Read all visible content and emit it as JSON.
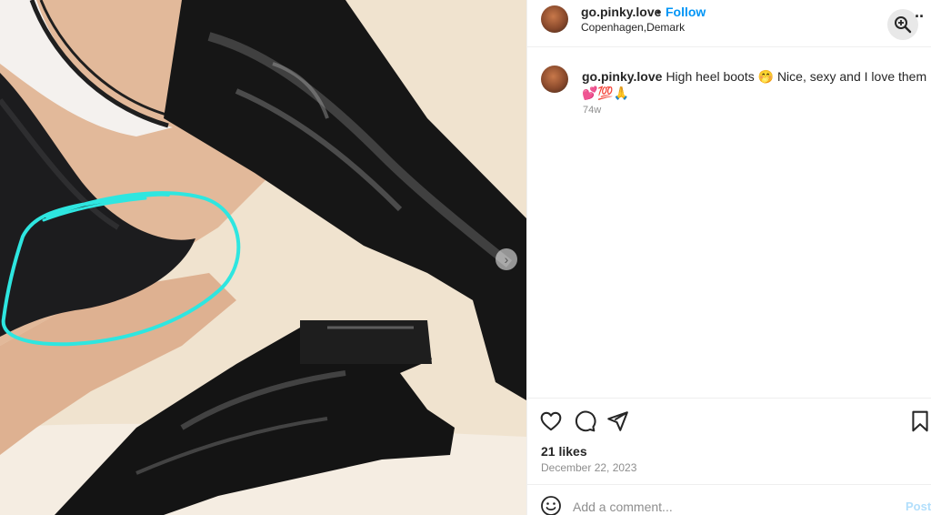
{
  "post": {
    "image_alt": "",
    "carousel_next": "›"
  },
  "header": {
    "username": "go.pinky.love",
    "separator": "•",
    "follow_label": "Follow",
    "location": "Copenhagen,Demark",
    "more_label": "··"
  },
  "caption": {
    "username": "go.pinky.love",
    "text": "High heel boots 🤭  Nice, sexy and I love them 💕💯🙏",
    "age": "74w"
  },
  "engagement": {
    "likes": "21 likes",
    "date": "December 22, 2023"
  },
  "comment": {
    "placeholder": "Add a comment...",
    "post_label": "Post"
  },
  "colors": {
    "accent": "#0095f6",
    "post_disabled": "#b2dffc",
    "annotation_circle": "#2ee6e0"
  },
  "icons": {
    "like": "heart-icon",
    "comment": "comment-bubble-icon",
    "share": "paper-plane-icon",
    "save": "bookmark-icon",
    "zoom": "zoom-in-icon",
    "emoji": "smiley-icon"
  }
}
